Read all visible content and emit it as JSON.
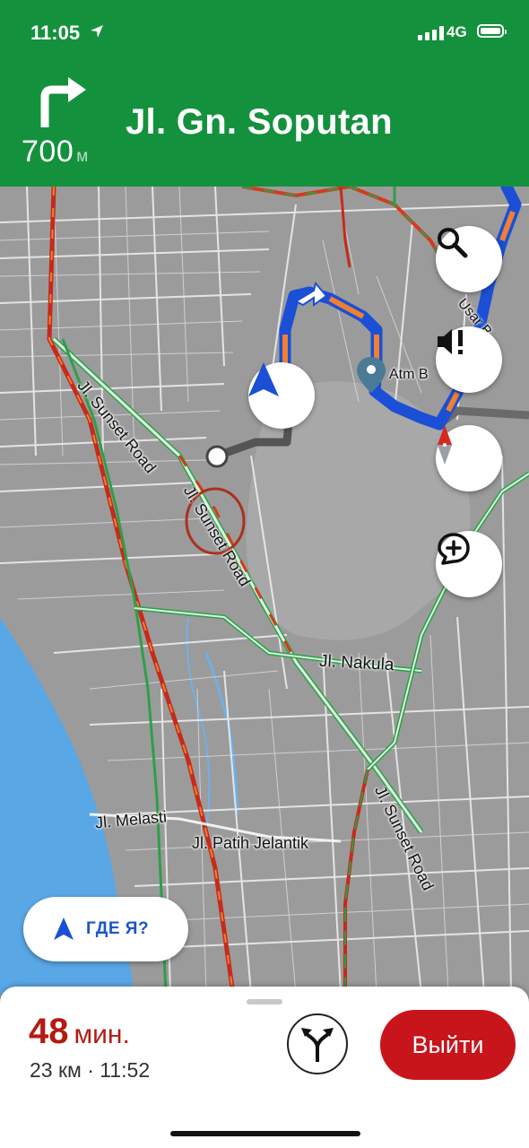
{
  "status_bar": {
    "time": "11:05",
    "network": "4G"
  },
  "navigation": {
    "distance_value": "700",
    "distance_unit": "м",
    "street": "Jl. Gn. Soputan",
    "turn_icon": "turn-right-arrow-icon"
  },
  "map": {
    "labels": {
      "sunset_road_1": "Jl. Sunset Road",
      "sunset_road_2": "Jl. Sunset Road",
      "sunset_road_3": "Jl. Sunset Road",
      "nakula": "Jl. Nakula",
      "melasti": "Jl. Melasti",
      "patih_jelantik": "Jl. Patih Jelantik",
      "atm": "Atm B",
      "usar": "Usar B"
    },
    "buttons": {
      "search": "search-icon",
      "sound": "sound-alert-icon",
      "compass": "compass-icon",
      "report": "add-report-icon"
    },
    "where_am_i_label": "ГДЕ Я?"
  },
  "trip": {
    "eta_value": "48",
    "eta_unit": "мин.",
    "distance_time": "23 км · 11:52",
    "exit_label": "Выйти",
    "alternate_routes_icon": "alternate-routes-icon"
  },
  "colors": {
    "header_green": "#14913d",
    "route_blue": "#1a4fd6",
    "exit_red": "#c8141b",
    "eta_red": "#b31b12",
    "water": "#5aa7e6"
  }
}
